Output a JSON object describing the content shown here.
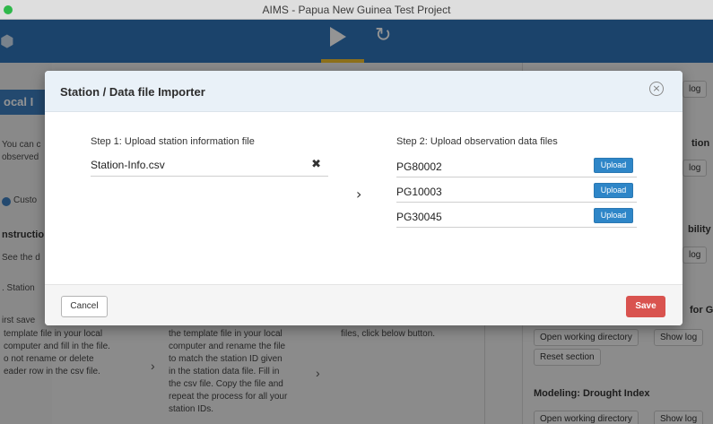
{
  "window": {
    "title": "AIMS - Papua New Guinea Test Project"
  },
  "app": {
    "local_tab": "ocal I",
    "left_texts": [
      "You can c",
      "observed",
      "Custo",
      "nstructio",
      "See the d",
      ". Station",
      "irst save"
    ],
    "center_col1": "template file in your local\ncomputer and fill in the file.\no not rename or delete\neader row in the csv file.",
    "center_col2": "the template file in your local\ncomputer and rename the file\nto match the station ID given\nin the station data file. Fill in\nthe csv file. Copy the file and\nrepeat the process for all your\nstation IDs.",
    "center_col3": "files, click below button.",
    "right_headers": [
      "tion",
      "bility",
      "for G",
      "Modeling: Drought Index"
    ],
    "right_buttons": {
      "log": "log",
      "open_working_directory": "Open working directory",
      "show_log": "Show log",
      "reset_section": "Reset section"
    }
  },
  "modal": {
    "title": "Station / Data file Importer",
    "close_glyph": "×",
    "step1": {
      "label": "Step 1: Upload station information file",
      "file_name": "Station-Info.csv",
      "clear_glyph": "✖"
    },
    "arrow_glyph": "›",
    "step2": {
      "label": "Step 2: Upload observation data files",
      "rows": [
        {
          "station_id": "PG80002",
          "button": "Upload"
        },
        {
          "station_id": "PG10003",
          "button": "Upload"
        },
        {
          "station_id": "PG30045",
          "button": "Upload"
        }
      ]
    },
    "footer": {
      "cancel": "Cancel",
      "save": "Save"
    }
  },
  "colors": {
    "header_blue": "#2f74b8",
    "upload_blue": "#2e86c8",
    "save_red": "#d9534f",
    "accent_yellow": "#f3c12f"
  }
}
